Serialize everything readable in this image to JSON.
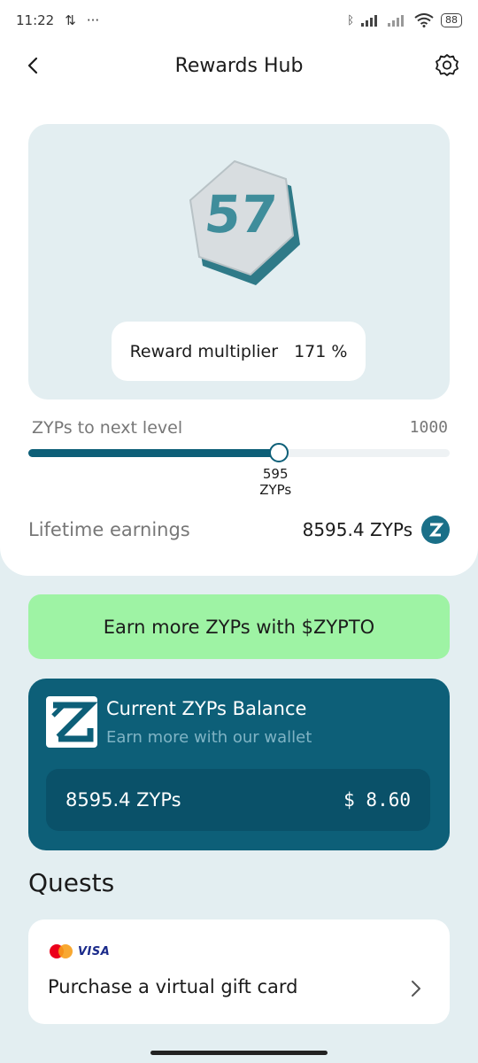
{
  "status_bar": {
    "time": "11:22",
    "battery": "88"
  },
  "header": {
    "title": "Rewards Hub"
  },
  "level_card": {
    "level": "57",
    "multiplier_label": "Reward multiplier",
    "multiplier_value": "171 %"
  },
  "progress": {
    "label": "ZYPs to next level",
    "max": "1000",
    "current_value": "595",
    "current_unit": "ZYPs",
    "fraction": 0.595
  },
  "lifetime": {
    "label": "Lifetime earnings",
    "value": "8595.4 ZYPs"
  },
  "earn_button": {
    "label": "Earn more ZYPs with $ZYPTO"
  },
  "balance_card": {
    "title": "Current ZYPs Balance",
    "subtitle": "Earn more with our wallet",
    "amount": "8595.4 ZYPs",
    "usd": "$ 8.60"
  },
  "quests": {
    "title": "Quests",
    "items": [
      {
        "payment_brand": "VISA",
        "label": "Purchase a virtual gift card"
      }
    ]
  },
  "colors": {
    "primary": "#0d5f78",
    "accent_green": "#9ef3a4",
    "card_bg": "#e3eef1"
  },
  "icons": {
    "back": "chevron-left-icon",
    "settings": "gear-icon",
    "coin": "zypto-coin-icon",
    "logo": "zypto-logo-icon",
    "chevron": "chevron-right-icon"
  }
}
